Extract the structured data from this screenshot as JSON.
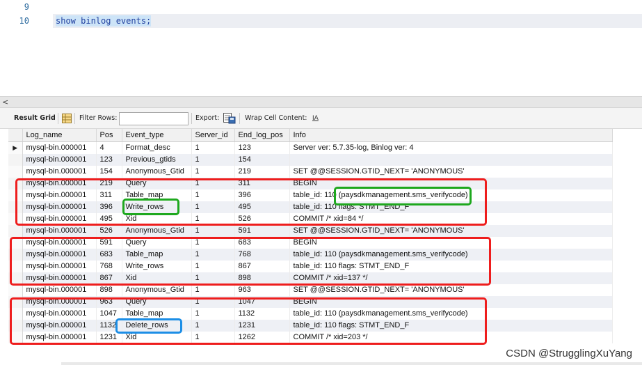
{
  "editor": {
    "lines": [
      {
        "num": "9",
        "code": ""
      },
      {
        "num": "10",
        "code": "show binlog events;"
      }
    ]
  },
  "scrollbar": {
    "left_arrow": "<"
  },
  "toolbar": {
    "result_grid": "Result Grid",
    "filter_rows": "Filter Rows:",
    "filter_value": "",
    "export": "Export:",
    "wrap_cell": "Wrap Cell Content:",
    "wrap_icon_glyph": "IA"
  },
  "grid": {
    "columns": [
      "Log_name",
      "Pos",
      "Event_type",
      "Server_id",
      "End_log_pos",
      "Info"
    ],
    "rows": [
      [
        "mysql-bin.000001",
        "4",
        "Format_desc",
        "1",
        "123",
        "Server ver: 5.7.35-log, Binlog ver: 4"
      ],
      [
        "mysql-bin.000001",
        "123",
        "Previous_gtids",
        "1",
        "154",
        ""
      ],
      [
        "mysql-bin.000001",
        "154",
        "Anonymous_Gtid",
        "1",
        "219",
        "SET @@SESSION.GTID_NEXT= 'ANONYMOUS'"
      ],
      [
        "mysql-bin.000001",
        "219",
        "Query",
        "1",
        "311",
        "BEGIN"
      ],
      [
        "mysql-bin.000001",
        "311",
        "Table_map",
        "1",
        "396",
        "table_id: 110 (paysdkmanagement.sms_verifycode)"
      ],
      [
        "mysql-bin.000001",
        "396",
        "Write_rows",
        "1",
        "495",
        "table_id: 110 flags: STMT_END_F"
      ],
      [
        "mysql-bin.000001",
        "495",
        "Xid",
        "1",
        "526",
        "COMMIT /* xid=84 */"
      ],
      [
        "mysql-bin.000001",
        "526",
        "Anonymous_Gtid",
        "1",
        "591",
        "SET @@SESSION.GTID_NEXT= 'ANONYMOUS'"
      ],
      [
        "mysql-bin.000001",
        "591",
        "Query",
        "1",
        "683",
        "BEGIN"
      ],
      [
        "mysql-bin.000001",
        "683",
        "Table_map",
        "1",
        "768",
        "table_id: 110 (paysdkmanagement.sms_verifycode)"
      ],
      [
        "mysql-bin.000001",
        "768",
        "Write_rows",
        "1",
        "867",
        "table_id: 110 flags: STMT_END_F"
      ],
      [
        "mysql-bin.000001",
        "867",
        "Xid",
        "1",
        "898",
        "COMMIT /* xid=137 */"
      ],
      [
        "mysql-bin.000001",
        "898",
        "Anonymous_Gtid",
        "1",
        "963",
        "SET @@SESSION.GTID_NEXT= 'ANONYMOUS'"
      ],
      [
        "mysql-bin.000001",
        "963",
        "Query",
        "1",
        "1047",
        "BEGIN"
      ],
      [
        "mysql-bin.000001",
        "1047",
        "Table_map",
        "1",
        "1132",
        "table_id: 110 (paysdkmanagement.sms_verifycode)"
      ],
      [
        "mysql-bin.000001",
        "1132",
        "Delete_rows",
        "1",
        "1231",
        "table_id: 110 flags: STMT_END_F"
      ],
      [
        "mysql-bin.000001",
        "1231",
        "Xid",
        "1",
        "1262",
        "COMMIT /* xid=203 */"
      ]
    ]
  },
  "annotation_colors": {
    "transaction": "#ee1d1d",
    "insert_highlight": "#1ea81e",
    "delete_highlight": "#1c8ee6"
  },
  "watermark": "CSDN @StrugglingXuYang"
}
